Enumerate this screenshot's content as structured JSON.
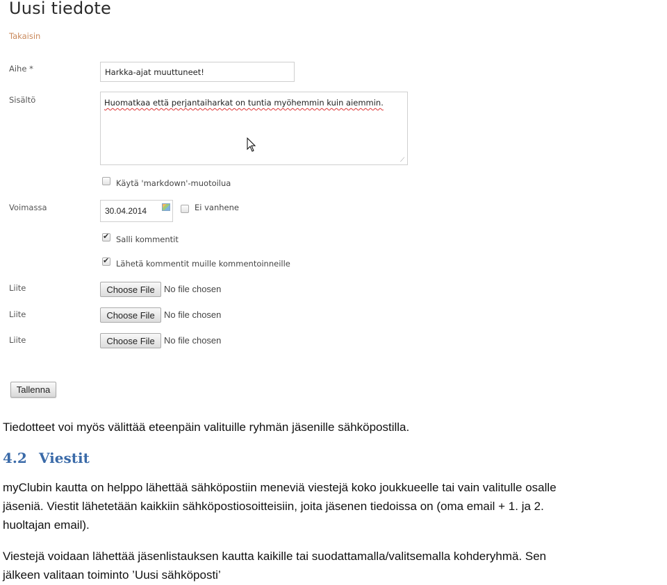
{
  "form": {
    "title": "Uusi tiedote",
    "back_link": "Takaisin",
    "subject": {
      "label": "Aihe *",
      "value": "Harkka-ajat muuttuneet!"
    },
    "content": {
      "label": "Sisältö",
      "value": "Huomatkaa että perjantaiharkat on tuntia myöhemmin kuin aiemmin."
    },
    "markdown_checkbox": {
      "label": "Käytä 'markdown'-muotoilua",
      "checked": false
    },
    "valid_until": {
      "label": "Voimassa",
      "value": "30.04.2014"
    },
    "never_expires": {
      "label": "Ei vanhene",
      "checked": false
    },
    "allow_comments": {
      "label": "Salli kommentit",
      "checked": true
    },
    "send_comments": {
      "label": "Lähetä kommentit muille kommentoinneille",
      "checked": true
    },
    "attachments": [
      {
        "label": "Liite",
        "button": "Choose File",
        "status": "No file chosen"
      },
      {
        "label": "Liite",
        "button": "Choose File",
        "status": "No file chosen"
      },
      {
        "label": "Liite",
        "button": "Choose File",
        "status": "No file chosen"
      }
    ],
    "save_button": "Tallenna"
  },
  "document": {
    "intro": "Tiedotteet voi myös välittää eteenpäin valituille ryhmän jäsenille sähköpostilla.",
    "section_number": "4.2",
    "section_title": "Viestit",
    "paragraph1_lines": [
      "myClubin kautta on helppo lähettää sähköpostiin meneviä viestejä koko joukkueelle tai vain valitulle osalle",
      "jäseniä. Viestit lähetetään kaikkiin sähköpostiosoitteisiin, joita jäsenen tiedoissa on (oma email + 1. ja 2.",
      "huoltajan email)."
    ],
    "paragraph2_lines": [
      "Viestejä voidaan lähettää jäsenlistauksen kautta kaikille tai suodattamalla/valitsemalla kohderyhmä. Sen",
      "jälkeen valitaan toiminto ’Uusi sähköposti’"
    ]
  }
}
